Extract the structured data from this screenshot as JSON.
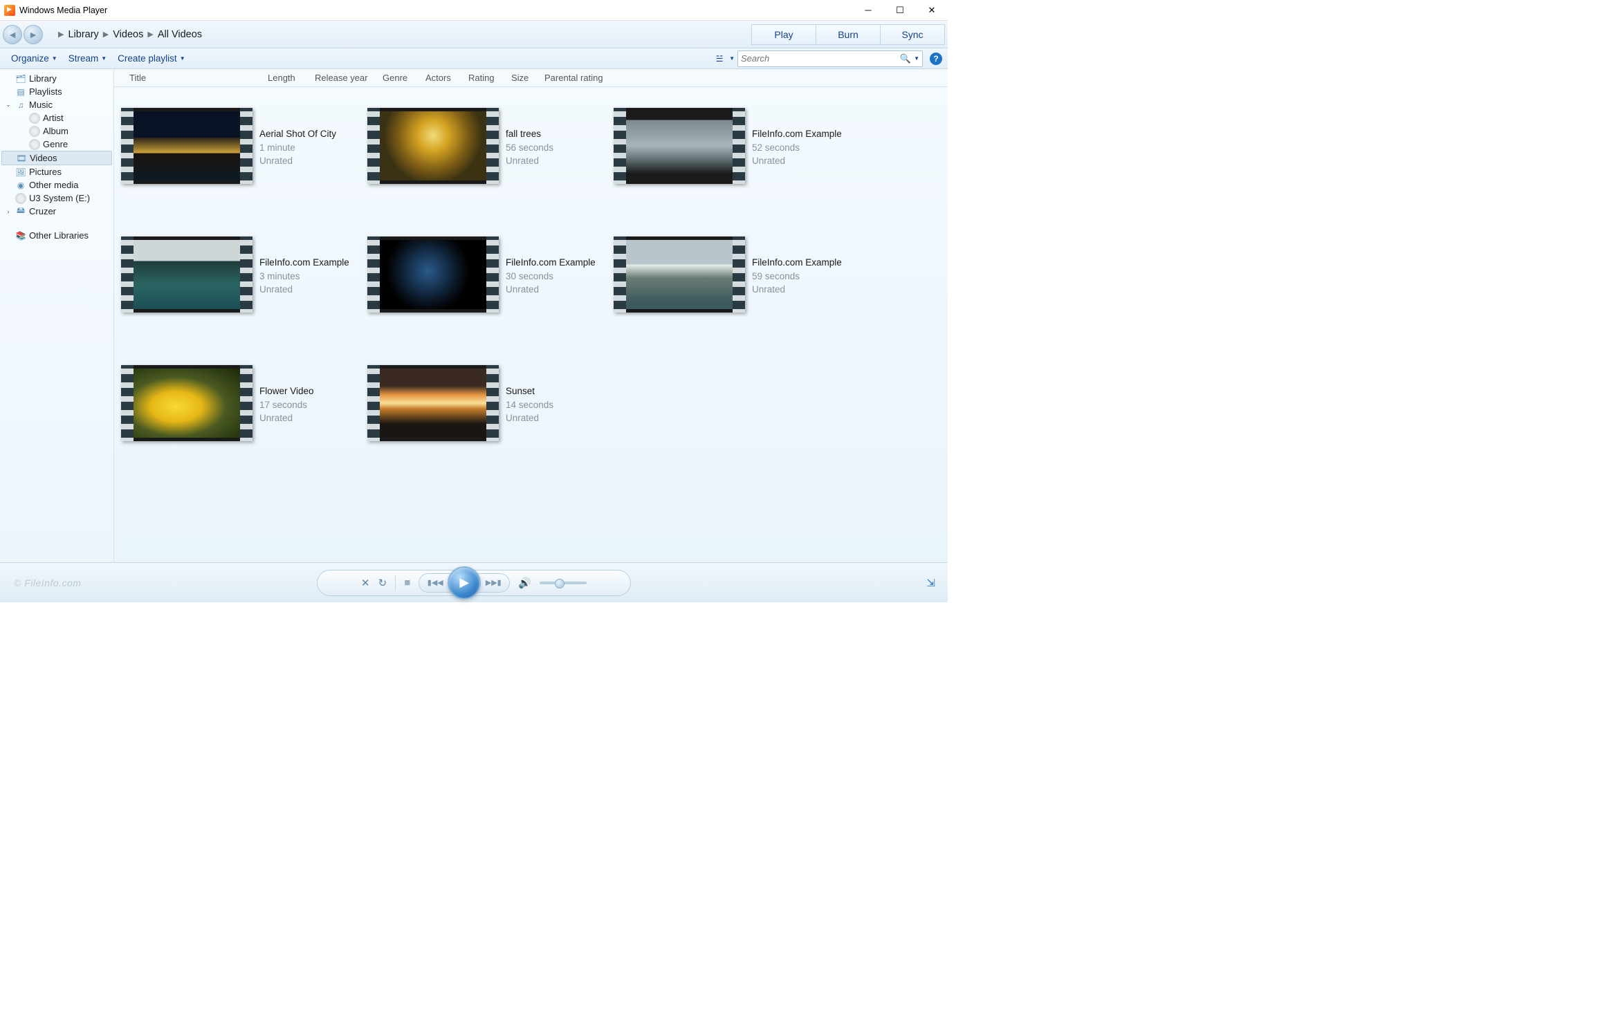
{
  "window": {
    "title": "Windows Media Player"
  },
  "breadcrumb": {
    "c1": "Library",
    "c2": "Videos",
    "c3": "All Videos"
  },
  "tabs": {
    "play": "Play",
    "burn": "Burn",
    "sync": "Sync"
  },
  "toolbar": {
    "organize": "Organize",
    "stream": "Stream",
    "create_playlist": "Create playlist"
  },
  "search": {
    "placeholder": "Search"
  },
  "sidebar": {
    "library": "Library",
    "playlists": "Playlists",
    "music": "Music",
    "artist": "Artist",
    "album": "Album",
    "genre": "Genre",
    "videos": "Videos",
    "pictures": "Pictures",
    "other_media": "Other media",
    "u3": "U3 System (E:)",
    "cruzer": "Cruzer",
    "other_libraries": "Other Libraries"
  },
  "columns": {
    "title": "Title",
    "length": "Length",
    "release_year": "Release year",
    "genre": "Genre",
    "actors": "Actors",
    "rating": "Rating",
    "size": "Size",
    "parental": "Parental rating"
  },
  "videos": [
    {
      "title": "Aerial Shot Of City",
      "length": "1 minute",
      "rating": "Unrated",
      "bg": "bg-city"
    },
    {
      "title": "fall trees",
      "length": "56 seconds",
      "rating": "Unrated",
      "bg": "bg-trees"
    },
    {
      "title": "FileInfo.com Example",
      "length": "52 seconds",
      "rating": "Unrated",
      "bg": "bg-wave"
    },
    {
      "title": "FileInfo.com Example",
      "length": "3 minutes",
      "rating": "Unrated",
      "bg": "bg-lake"
    },
    {
      "title": "FileInfo.com Example",
      "length": "30 seconds",
      "rating": "Unrated",
      "bg": "bg-earth"
    },
    {
      "title": "FileInfo.com Example",
      "length": "59 seconds",
      "rating": "Unrated",
      "bg": "bg-mtn"
    },
    {
      "title": "Flower Video",
      "length": "17 seconds",
      "rating": "Unrated",
      "bg": "bg-flower"
    },
    {
      "title": "Sunset",
      "length": "14 seconds",
      "rating": "Unrated",
      "bg": "bg-sunset"
    }
  ],
  "watermark": "© FileInfo.com"
}
